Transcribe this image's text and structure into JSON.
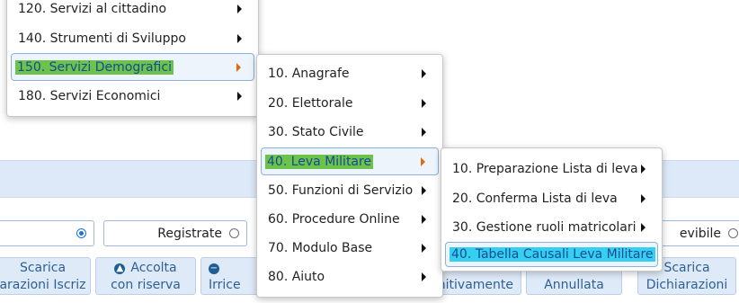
{
  "filters": {
    "registrate": "Registrate",
    "revibile": "evibile"
  },
  "toolbar": {
    "scarica_iscriz": [
      "Scarica",
      "arazioni Iscriz"
    ],
    "accolta": [
      "Accolta",
      "con riserva"
    ],
    "irrice": "Irrice",
    "nitivamente": "nitivamente",
    "annullata": "Annullata",
    "scarica_dich": [
      "Scarica",
      "Dichiarazioni"
    ]
  },
  "menu_level1": {
    "items": [
      {
        "label": "120. Servizi al cittadino"
      },
      {
        "label": "140. Strumenti di Sviluppo"
      },
      {
        "label": "150. Servizi Demografici"
      },
      {
        "label": "180. Servizi Economici"
      }
    ]
  },
  "menu_level2": {
    "items": [
      {
        "label": "10. Anagrafe"
      },
      {
        "label": "20. Elettorale"
      },
      {
        "label": "30. Stato Civile"
      },
      {
        "label": "40. Leva Militare"
      },
      {
        "label": "50. Funzioni di Servizio"
      },
      {
        "label": "60. Procedure Online"
      },
      {
        "label": "70. Modulo Base"
      },
      {
        "label": "80. Aiuto"
      }
    ]
  },
  "menu_level3": {
    "items": [
      {
        "label": "10. Preparazione Lista di leva"
      },
      {
        "label": "20. Conferma Lista di leva"
      },
      {
        "label": "30. Gestione ruoli matricolari"
      },
      {
        "label": "40. Tabella Causali Leva Militare"
      }
    ]
  },
  "colors": {
    "menu_highlight_level1": "#6cc24a",
    "menu_highlight_level2": "#6cc24a",
    "menu_highlight_level3": "#35d0f0",
    "active_arrow": "#e06b10"
  }
}
